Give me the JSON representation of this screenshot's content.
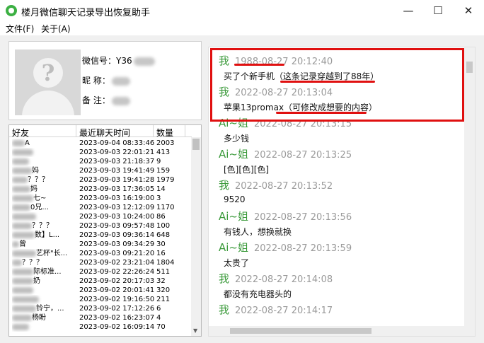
{
  "window": {
    "title": "楼月微信聊天记录导出恢复助手",
    "controls": {
      "minimize": "—",
      "maximize": "☐",
      "close": "✕"
    }
  },
  "menu": {
    "file": "文件(F)",
    "about": "关于(A)"
  },
  "profile": {
    "wechat_id_label": "微信号：",
    "wechat_id_value": "Y36",
    "nickname_label": "昵 称：",
    "remark_label": "备 注："
  },
  "friends_table": {
    "headers": [
      "好友",
      "最近聊天时间",
      "数量"
    ],
    "rows": [
      {
        "name": "A",
        "time": "2023-09-04 08:33:46",
        "count": "2003"
      },
      {
        "name": "",
        "time": "2023-09-03 22:01:21",
        "count": "413"
      },
      {
        "name": "",
        "time": "2023-09-03 21:18:37",
        "count": "9"
      },
      {
        "name": "妈",
        "time": "2023-09-03 19:41:49",
        "count": "159"
      },
      {
        "name": "？？？",
        "time": "2023-09-03 19:41:28",
        "count": "1979"
      },
      {
        "name": "妈",
        "time": "2023-09-03 17:36:05",
        "count": "14"
      },
      {
        "name": "七~",
        "time": "2023-09-03 16:19:00",
        "count": "3"
      },
      {
        "name": "0兄...",
        "time": "2023-09-03 12:12:09",
        "count": "1170"
      },
      {
        "name": "",
        "time": "2023-09-03 10:24:00",
        "count": "86"
      },
      {
        "name": "？？？",
        "time": "2023-09-03 09:57:48",
        "count": "100"
      },
      {
        "name": "数】L...",
        "time": "2023-09-03 09:36:14",
        "count": "648"
      },
      {
        "name": "曾",
        "time": "2023-09-03 09:34:29",
        "count": "30"
      },
      {
        "name": "艺杯\"长...",
        "time": "2023-09-03 09:21:20",
        "count": "16"
      },
      {
        "name": "？？？",
        "time": "2023-09-02 23:21:04",
        "count": "1804"
      },
      {
        "name": "际标准...",
        "time": "2023-09-02 22:26:24",
        "count": "511"
      },
      {
        "name": "奶",
        "time": "2023-09-02 20:17:03",
        "count": "32"
      },
      {
        "name": "",
        "time": "2023-09-02 20:01:41",
        "count": "320"
      },
      {
        "name": "",
        "time": "2023-09-02 19:16:50",
        "count": "211"
      },
      {
        "name": "铃宁，...",
        "time": "2023-09-02 17:12:26",
        "count": "6"
      },
      {
        "name": "杨盼",
        "time": "2023-09-02 16:23:07",
        "count": "4"
      },
      {
        "name": "",
        "time": "2023-09-02 16:09:14",
        "count": "70"
      }
    ]
  },
  "chat": {
    "messages": [
      {
        "sender": "我",
        "date": "1988-08-27",
        "time": "20:12:40",
        "text": "买了个新手机（这条记录穿越到了88年）"
      },
      {
        "sender": "我",
        "date": "2022-08-27",
        "time": "20:13:04",
        "text": "苹果13promax（可修改成想要的内容）"
      },
      {
        "sender": "Ai~姐",
        "date": "2022-08-27",
        "time": "20:13:15",
        "text": "多少钱"
      },
      {
        "sender": "Ai~姐",
        "date": "2022-08-27",
        "time": "20:13:25",
        "text": "[色][色][色]"
      },
      {
        "sender": "我",
        "date": "2022-08-27",
        "time": "20:13:52",
        "text": "9520"
      },
      {
        "sender": "Ai~姐",
        "date": "2022-08-27",
        "time": "20:13:56",
        "text": "有钱人，想换就换"
      },
      {
        "sender": "Ai~姐",
        "date": "2022-08-27",
        "time": "20:13:59",
        "text": "太贵了"
      },
      {
        "sender": "我",
        "date": "2022-08-27",
        "time": "20:14:08",
        "text": "都没有充电器头的"
      },
      {
        "sender": "我",
        "date": "2022-08-27",
        "time": "20:14:17",
        "text": ""
      }
    ]
  },
  "colors": {
    "annotation_red": "#e01010",
    "sender_green": "#3a9a3a",
    "timestamp_gray": "#9a9a9a"
  }
}
